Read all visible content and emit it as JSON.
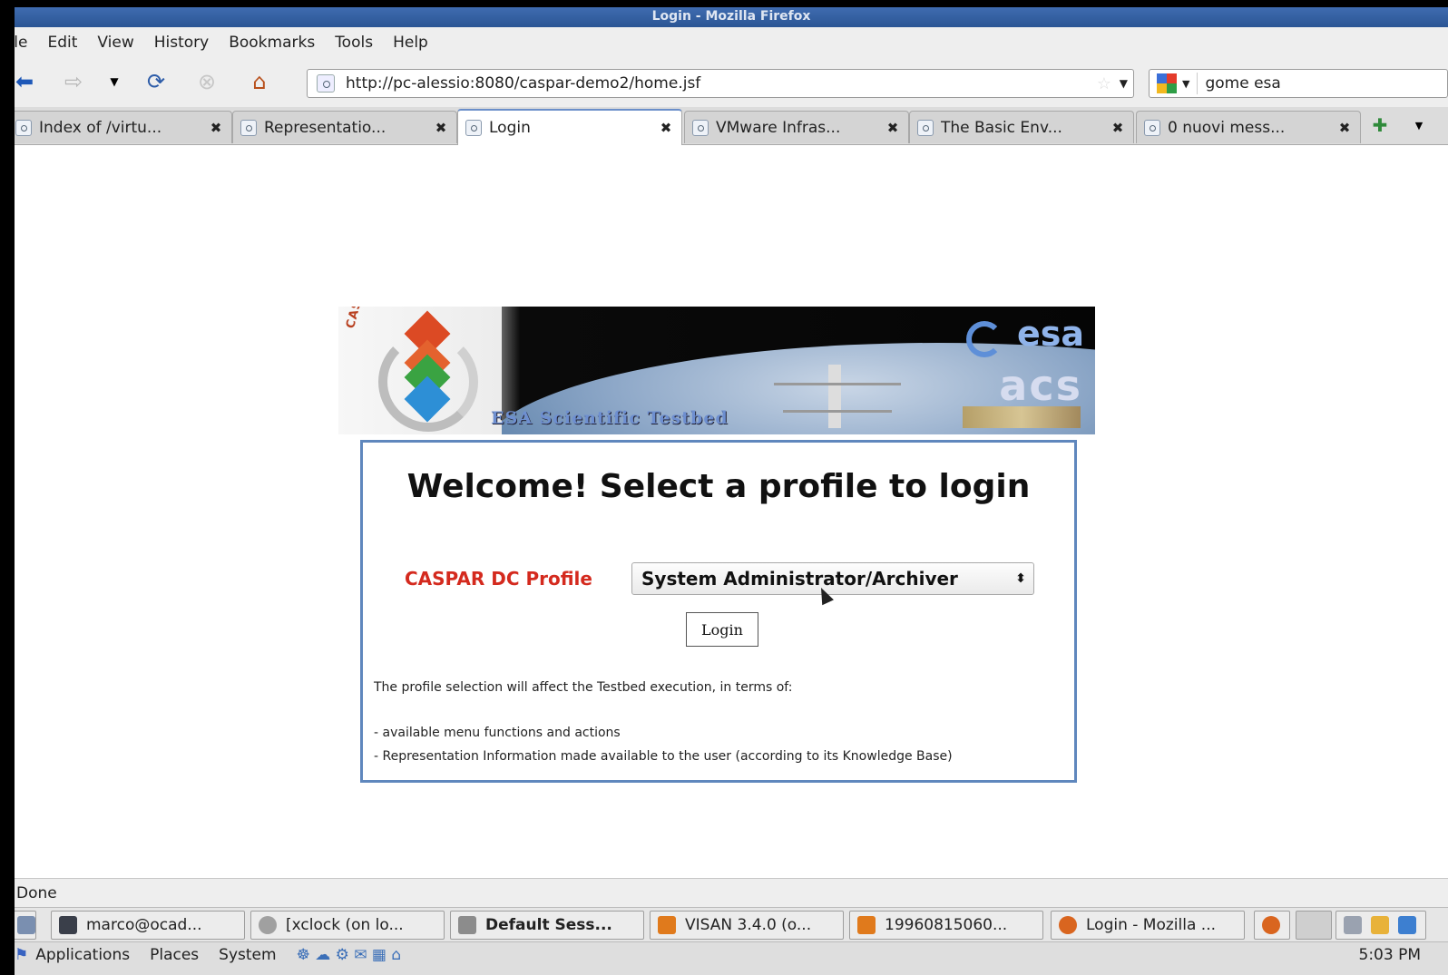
{
  "window": {
    "title": "Login - Mozilla Firefox"
  },
  "menu": [
    "File",
    "Edit",
    "View",
    "History",
    "Bookmarks",
    "Tools",
    "Help"
  ],
  "nav": {
    "url": "http://pc-alessio:8080/caspar-demo2/home.jsf",
    "search_value": "gome esa"
  },
  "tabs": [
    {
      "label": "Index of /virtu...",
      "active": false
    },
    {
      "label": "Representatio...",
      "active": false
    },
    {
      "label": "Login",
      "active": true
    },
    {
      "label": "VMware Infras...",
      "active": false
    },
    {
      "label": "The Basic Env...",
      "active": false
    },
    {
      "label": "0 nuovi mess...",
      "active": false
    }
  ],
  "banner": {
    "caspar_text": "CASPAR",
    "esa_text": "esa",
    "acs_text": "acs",
    "science_text": "ESA Scientific Testbed"
  },
  "login": {
    "heading": "Welcome! Select a profile to login",
    "profile_label": "CASPAR DC Profile",
    "profile_selected": "System Administrator/Archiver",
    "login_button": "Login",
    "info_line1": "The profile selection will affect the Testbed execution, in terms of:",
    "info_line2": "- available menu functions and actions",
    "info_line3": "- Representation Information made available to the user (according to its Knowledge Base)"
  },
  "status": {
    "text": "Done"
  },
  "taskbar": [
    {
      "label": "marco@ocad...",
      "icon": "terminal-icon",
      "bold": false
    },
    {
      "label": "[xclock (on lo...",
      "icon": "clock-icon",
      "bold": false
    },
    {
      "label": "Default Sess...",
      "icon": "session-icon",
      "bold": true
    },
    {
      "label": "VISAN 3.4.0 (o...",
      "icon": "visan-icon",
      "bold": false
    },
    {
      "label": "19960815060...",
      "icon": "visan-icon",
      "bold": false
    },
    {
      "label": "Login - Mozilla ...",
      "icon": "firefox-icon",
      "bold": false
    }
  ],
  "panel": {
    "applications": "Applications",
    "places": "Places",
    "system": "System",
    "clock": "5:03 PM"
  },
  "colors": {
    "profile_label": "#d42a1e",
    "login_border": "#5f87bd"
  }
}
